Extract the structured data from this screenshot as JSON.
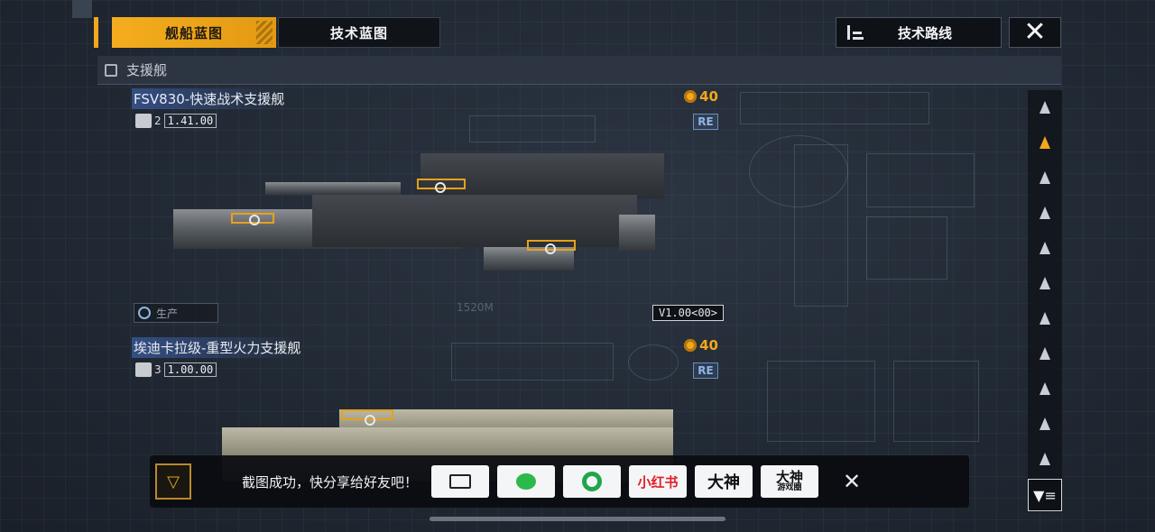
{
  "tabs": [
    {
      "label": "舰船蓝图",
      "active": true
    },
    {
      "label": "技术蓝图",
      "active": false
    }
  ],
  "route_button": {
    "label": "技术路线",
    "icon": "list-tree-icon"
  },
  "close_icon": "close-icon",
  "section": {
    "label": "支援舰",
    "icon": "support-ship-category-icon"
  },
  "ships": [
    {
      "name": "FSV830-快速战术支援舰",
      "tier": "2",
      "value": "1.41.00",
      "cost": "40",
      "tag": "RE",
      "production_label": "生产",
      "version": "V1.00<00>",
      "scale": "1520M"
    },
    {
      "name": "埃迪卡拉级-重型火力支援舰",
      "tier": "3",
      "value": "1.00.00",
      "cost": "40",
      "tag": "RE"
    }
  ],
  "side_nav": {
    "items": [
      "ship-class-1-icon",
      "support-ship-icon",
      "ship-class-3-icon",
      "ship-class-4-icon",
      "ship-class-5-icon",
      "ship-class-6-icon",
      "ship-class-7-icon",
      "ship-class-8-icon",
      "ship-class-9-icon",
      "ship-class-10-icon",
      "ship-class-11-icon"
    ],
    "active_index": 1,
    "filter_icon": "filter-icon"
  },
  "share_bar": {
    "message": "截图成功，快分享给好友吧！",
    "buttons": [
      {
        "id": "screenshot",
        "label": ""
      },
      {
        "id": "wechat",
        "label": ""
      },
      {
        "id": "moments",
        "label": ""
      },
      {
        "id": "xiaohongshu",
        "label": "小红书"
      },
      {
        "id": "dashen",
        "label": "大神"
      },
      {
        "id": "dashen-circle",
        "label": "大神",
        "sublabel": "游戏圈"
      }
    ],
    "close_icon": "close-icon"
  },
  "colors": {
    "accent": "#f2a71c",
    "background": "#212934",
    "re_tag": "#8fb6e4"
  }
}
